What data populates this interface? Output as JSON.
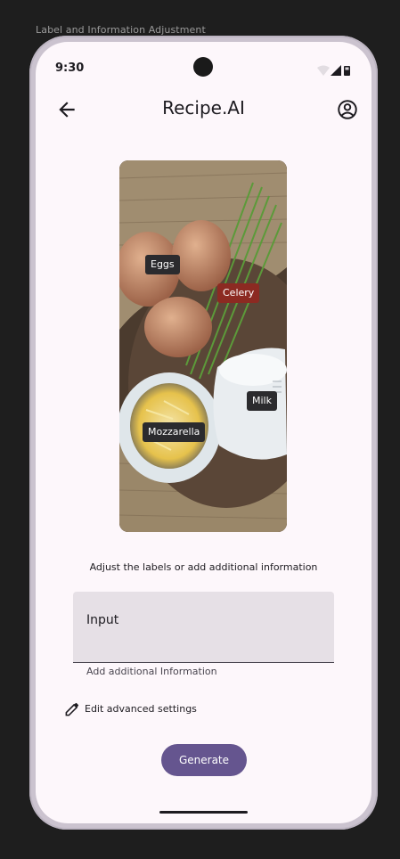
{
  "frame_label": "Label and Information Adjustment",
  "status_bar": {
    "time": "9:30",
    "icons": [
      "wifi-icon",
      "signal-icon",
      "battery-icon"
    ]
  },
  "app_bar": {
    "title": "Recipe.AI",
    "back_icon": "arrow-left-icon",
    "account_icon": "account-circle-icon"
  },
  "image": {
    "subject": "ingredients photo",
    "icon": "photo-icon"
  },
  "labels": [
    {
      "text": "Eggs",
      "variant": "default"
    },
    {
      "text": "Celery",
      "variant": "danger"
    },
    {
      "text": "Milk",
      "variant": "default"
    },
    {
      "text": "Mozzarella",
      "variant": "default"
    }
  ],
  "instruction": "Adjust the labels or add additional information",
  "input": {
    "value": "Input",
    "helper": "Add additional Information"
  },
  "advanced": {
    "label": "Edit advanced settings",
    "icon": "pencil-icon"
  },
  "generate_button": {
    "label": "Generate"
  },
  "colors": {
    "primary": "#65558f",
    "surface": "#fdf7fb",
    "danger_chip": "#8c2a22",
    "default_chip": "#2b2b2e",
    "input_fill": "#e6e0e6"
  }
}
